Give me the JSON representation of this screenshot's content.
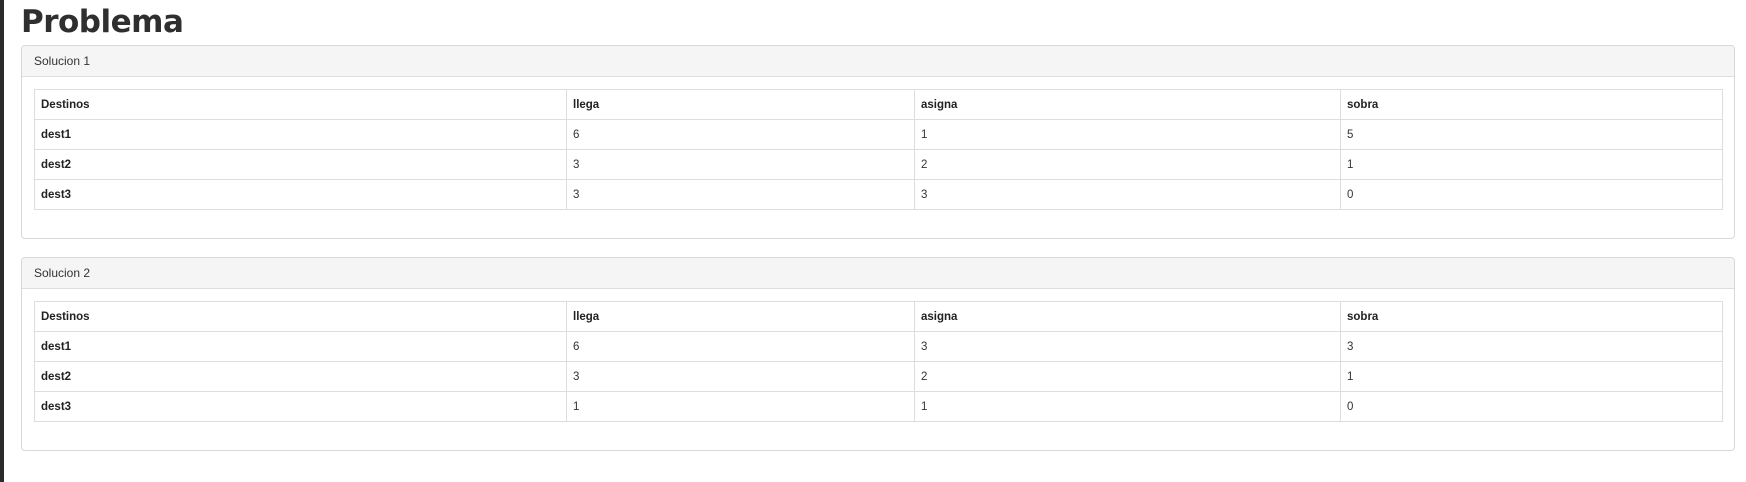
{
  "page": {
    "title": "Problema"
  },
  "panels": [
    {
      "heading": "Solucion 1",
      "columns": [
        "Destinos",
        "llega",
        "asigna",
        "sobra"
      ],
      "rows": [
        {
          "destino": "dest1",
          "llega": "6",
          "asigna": "1",
          "sobra": "5"
        },
        {
          "destino": "dest2",
          "llega": "3",
          "asigna": "2",
          "sobra": "1"
        },
        {
          "destino": "dest3",
          "llega": "3",
          "asigna": "3",
          "sobra": "0"
        }
      ]
    },
    {
      "heading": "Solucion 2",
      "columns": [
        "Destinos",
        "llega",
        "asigna",
        "sobra"
      ],
      "rows": [
        {
          "destino": "dest1",
          "llega": "6",
          "asigna": "3",
          "sobra": "3"
        },
        {
          "destino": "dest2",
          "llega": "3",
          "asigna": "2",
          "sobra": "1"
        },
        {
          "destino": "dest3",
          "llega": "1",
          "asigna": "1",
          "sobra": "0"
        }
      ]
    }
  ]
}
